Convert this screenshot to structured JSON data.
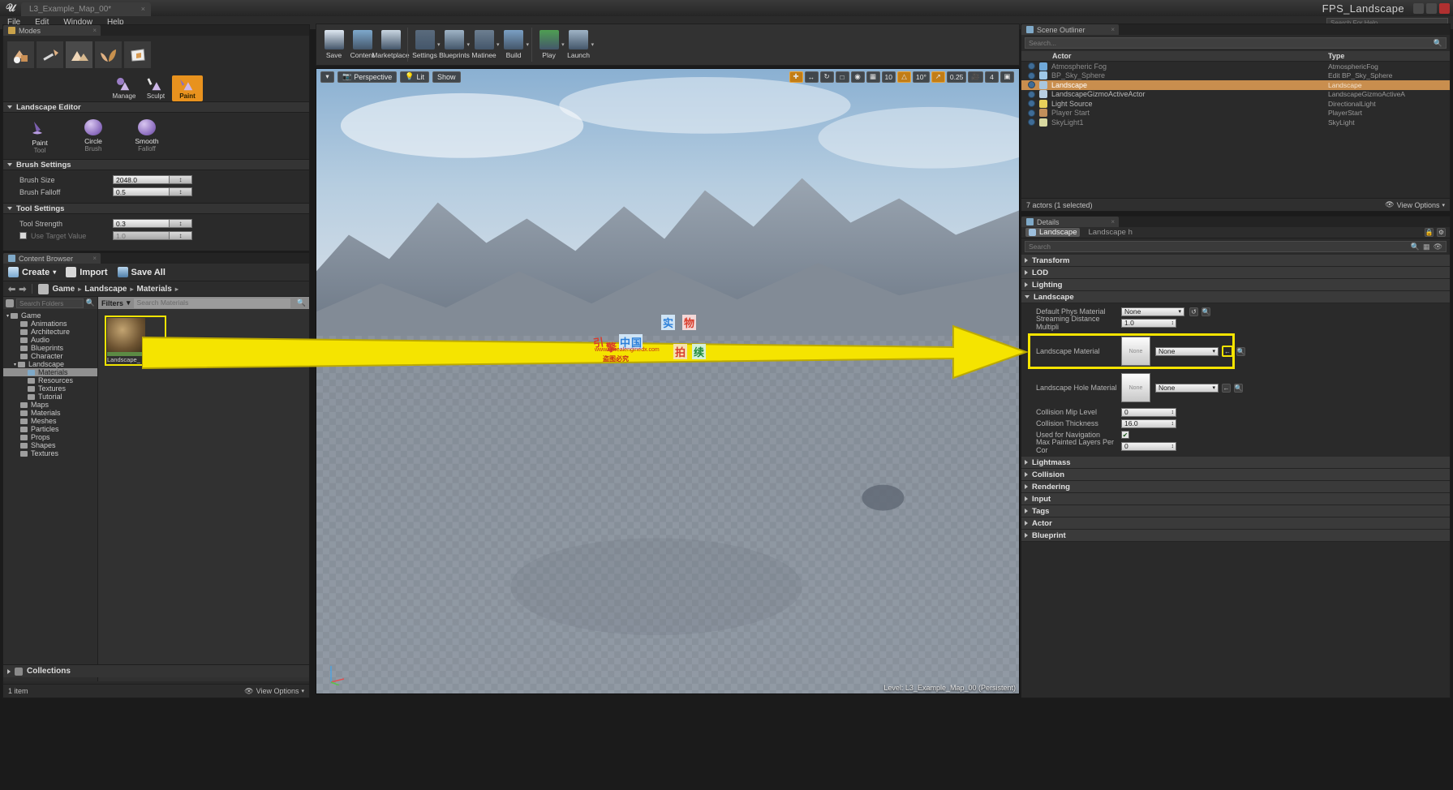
{
  "window": {
    "document_tab": "L3_Example_Map_00*",
    "app_title": "FPS_Landscape",
    "search_help_placeholder": "Search For Help"
  },
  "menu": {
    "items": [
      "File",
      "Edit",
      "Window",
      "Help"
    ]
  },
  "modes_panel": {
    "tab_label": "Modes",
    "tab_close": "×",
    "mode_buttons": [
      {
        "name": "place-mode",
        "selected": false
      },
      {
        "name": "paint-mode",
        "selected": false
      },
      {
        "name": "landscape-mode",
        "selected": true
      },
      {
        "name": "foliage-mode",
        "selected": false
      },
      {
        "name": "geometry-mode",
        "selected": false
      }
    ],
    "landscape_tools": [
      {
        "label": "Manage",
        "active": false
      },
      {
        "label": "Sculpt",
        "active": false
      },
      {
        "label": "Paint",
        "active": true
      }
    ],
    "sections": {
      "landscape_editor": "Landscape Editor",
      "brush_settings": "Brush Settings",
      "tool_settings": "Tool Settings"
    },
    "tool_row": [
      {
        "title": "Paint",
        "subtitle": "Tool"
      },
      {
        "title": "Circle",
        "subtitle": "Brush"
      },
      {
        "title": "Smooth",
        "subtitle": "Falloff"
      }
    ],
    "brush_props": [
      {
        "name": "Brush Size",
        "value": "2048.0"
      },
      {
        "name": "Brush Falloff",
        "value": "0.5"
      }
    ],
    "tool_props": [
      {
        "name": "Tool Strength",
        "value": "0.3",
        "disabled": false,
        "checkbox": false
      },
      {
        "name": "Use Target Value",
        "value": "1.0",
        "disabled": true,
        "checkbox": true
      }
    ]
  },
  "content_browser": {
    "tab_label": "Content Browser",
    "tab_close": "×",
    "toolbar": [
      {
        "label": "Create",
        "caret": "▾"
      },
      {
        "label": "Import",
        "caret": ""
      },
      {
        "label": "Save All",
        "caret": ""
      }
    ],
    "breadcrumb": [
      "Game",
      "Landscape",
      "Materials"
    ],
    "breadcrumb_sep": "▸",
    "folder_search_placeholder": "Search Folders",
    "folder_tree": [
      {
        "label": "Game",
        "depth": 0,
        "expanded": true,
        "selected": false
      },
      {
        "label": "Animations",
        "depth": 1,
        "expanded": null,
        "selected": false
      },
      {
        "label": "Architecture",
        "depth": 1,
        "expanded": null,
        "selected": false
      },
      {
        "label": "Audio",
        "depth": 1,
        "expanded": null,
        "selected": false
      },
      {
        "label": "Blueprints",
        "depth": 1,
        "expanded": null,
        "selected": false
      },
      {
        "label": "Character",
        "depth": 1,
        "expanded": null,
        "selected": false
      },
      {
        "label": "Landscape",
        "depth": 1,
        "expanded": true,
        "selected": false
      },
      {
        "label": "Materials",
        "depth": 2,
        "expanded": null,
        "selected": true
      },
      {
        "label": "Resources",
        "depth": 2,
        "expanded": null,
        "selected": false
      },
      {
        "label": "Textures",
        "depth": 2,
        "expanded": null,
        "selected": false
      },
      {
        "label": "Tutorial",
        "depth": 2,
        "expanded": null,
        "selected": false
      },
      {
        "label": "Maps",
        "depth": 1,
        "expanded": null,
        "selected": false
      },
      {
        "label": "Materials",
        "depth": 1,
        "expanded": null,
        "selected": false
      },
      {
        "label": "Meshes",
        "depth": 1,
        "expanded": null,
        "selected": false
      },
      {
        "label": "Particles",
        "depth": 1,
        "expanded": null,
        "selected": false
      },
      {
        "label": "Props",
        "depth": 1,
        "expanded": null,
        "selected": false
      },
      {
        "label": "Shapes",
        "depth": 1,
        "expanded": null,
        "selected": false
      },
      {
        "label": "Textures",
        "depth": 1,
        "expanded": null,
        "selected": false
      }
    ],
    "filters_label": "Filters",
    "filters_caret": "▾",
    "asset_search_placeholder": "Search Materials",
    "assets": [
      {
        "name": "Landscape_\nMaterial",
        "selected": true
      }
    ],
    "collections_label": "Collections",
    "status_count": "1 item",
    "view_options_label": "View Options"
  },
  "main_toolbar": {
    "items": [
      {
        "label": "Save",
        "caret": false
      },
      {
        "label": "Content",
        "caret": false
      },
      {
        "label": "Marketplace",
        "caret": false
      },
      {
        "label": "Settings",
        "caret": true
      },
      {
        "label": "Blueprints",
        "caret": true
      },
      {
        "label": "Matinee",
        "caret": true
      },
      {
        "label": "Build",
        "caret": true
      },
      {
        "label": "Play",
        "caret": true
      },
      {
        "label": "Launch",
        "caret": true
      }
    ]
  },
  "viewport": {
    "view_caret": "▾",
    "view_mode": "Perspective",
    "lit_mode": "Lit",
    "show_menu": "Show",
    "grid_snap_value": "10",
    "rotation_snap_value": "10°",
    "scale_snap_value": "0.25",
    "camera_speed_value": "4",
    "status_text": "Level:  L3_Example_Map_00 (Persistent)"
  },
  "scene_outliner": {
    "tab_label": "Scene Outliner",
    "tab_close": "×",
    "search_placeholder": "Search...",
    "columns": {
      "actor": "Actor",
      "type": "Type"
    },
    "rows": [
      {
        "name": "Atmospheric Fog",
        "type": "AtmosphericFog",
        "selected": false,
        "dim": true
      },
      {
        "name": "BP_Sky_Sphere",
        "type": "Edit BP_Sky_Sphere",
        "selected": false,
        "dim": true
      },
      {
        "name": "Landscape",
        "type": "Landscape",
        "selected": true,
        "dim": false
      },
      {
        "name": "LandscapeGizmoActiveActor",
        "type": "LandscapeGizmoActiveA",
        "selected": false,
        "dim": false
      },
      {
        "name": "Light Source",
        "type": "DirectionalLight",
        "selected": false,
        "dim": false
      },
      {
        "name": "Player Start",
        "type": "PlayerStart",
        "selected": false,
        "dim": true
      },
      {
        "name": "SkyLight1",
        "type": "SkyLight",
        "selected": false,
        "dim": true
      }
    ],
    "footer_count": "7 actors (1 selected)",
    "view_options_label": "View Options"
  },
  "details": {
    "tab_label": "Details",
    "tab_close": "×",
    "object_tabs": [
      {
        "label": "Landscape",
        "selected": true
      },
      {
        "label": "Landscape h",
        "selected": false
      }
    ],
    "search_placeholder": "Search",
    "categories_top": [
      "Transform",
      "LOD",
      "Lighting"
    ],
    "landscape_category": "Landscape",
    "properties": [
      {
        "name": "Default Phys Material",
        "kind": "combo",
        "value": "None"
      },
      {
        "name": "Streaming Distance Multipli",
        "kind": "value",
        "value": "1.0"
      }
    ],
    "landscape_material": {
      "name": "Landscape Material",
      "thumb_text": "None",
      "combo_value": "None",
      "highlighted": true
    },
    "landscape_hole_material": {
      "name": "Landscape Hole Material",
      "thumb_text": "None",
      "combo_value": "None"
    },
    "properties_tail": [
      {
        "name": "Collision Mip Level",
        "kind": "value",
        "value": "0"
      },
      {
        "name": "Collision Thickness",
        "kind": "value",
        "value": "16.0"
      },
      {
        "name": "Used for Navigation",
        "kind": "check",
        "value": "✔"
      },
      {
        "name": "Max Painted Layers Per Cor",
        "kind": "value",
        "value": "0"
      }
    ],
    "categories_bottom": [
      "Lightmass",
      "Collision",
      "Rendering",
      "Input",
      "Tags",
      "Actor",
      "Blueprint"
    ]
  },
  "annotation": {
    "arrow_color": "#f5e400",
    "watermark_chars": [
      "引",
      "擎",
      "中",
      "国",
      "实",
      "物",
      "拍",
      "续"
    ],
    "watermark_url": "www.unrealenginedx.com",
    "watermark_text": "盗图必究"
  }
}
